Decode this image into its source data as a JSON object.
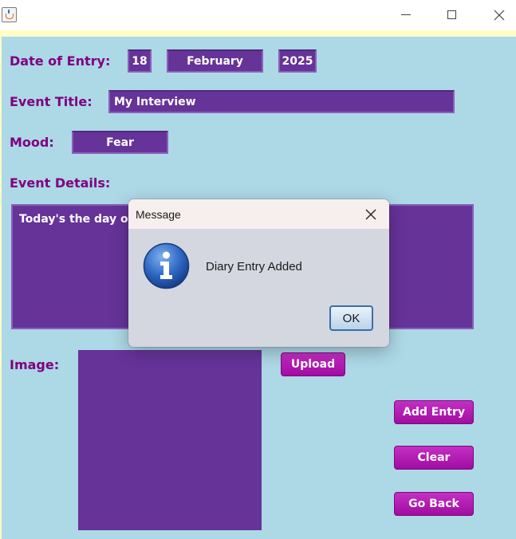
{
  "window": {
    "icon": "java-cup-icon",
    "controls": [
      "minimize-icon",
      "maximize-icon",
      "close-icon"
    ]
  },
  "form": {
    "date_label": "Date of Entry:",
    "day": "18",
    "month": "February",
    "year": "2025",
    "title_label": "Event Title:",
    "title_value": "My Interview",
    "mood_label": "Mood:",
    "mood_value": "Fear",
    "details_label": "Event Details:",
    "details_value": "Today's the day of my",
    "image_label": "Image:"
  },
  "buttons": {
    "upload": "Upload",
    "add_entry": "Add Entry",
    "clear": "Clear",
    "go_back": "Go Back"
  },
  "dialog": {
    "title": "Message",
    "message": "Diary Entry Added",
    "ok": "OK",
    "icon": "information-icon"
  },
  "colors": {
    "background": "#add8e6",
    "strip": "#ffffc6",
    "label": "#800080",
    "field": "#663399",
    "button": "#b01ab0"
  }
}
